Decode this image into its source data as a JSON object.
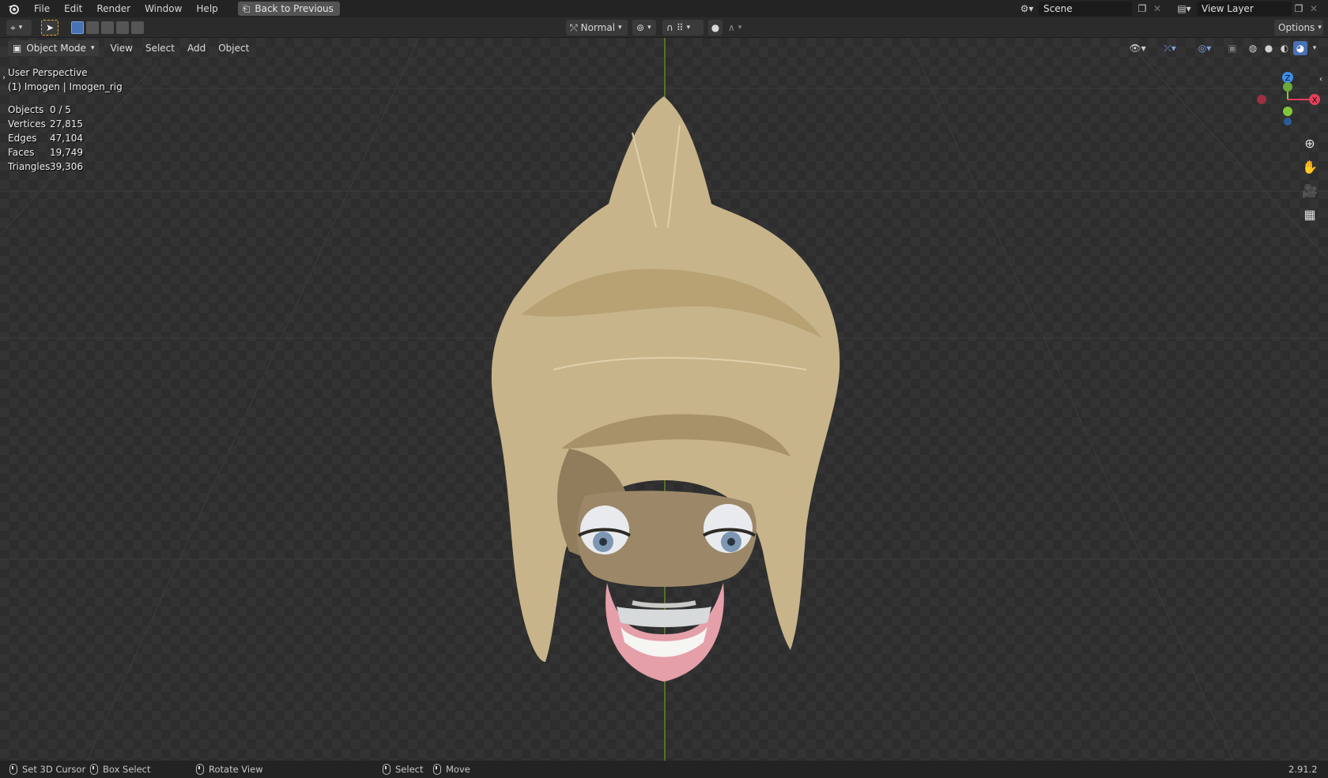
{
  "topbar": {
    "menu": [
      "File",
      "Edit",
      "Render",
      "Window",
      "Help"
    ],
    "back_button": "Back to Previous",
    "scene": "Scene",
    "view_layer": "View Layer"
  },
  "toolbar": {
    "orientation": "Normal",
    "options": "Options"
  },
  "viewport_header": {
    "mode": "Object Mode",
    "menu": [
      "View",
      "Select",
      "Add",
      "Object"
    ]
  },
  "overlay": {
    "perspective": "User Perspective",
    "object": "(1) Imogen | Imogen_rig"
  },
  "stats": [
    {
      "label": "Objects",
      "value": "0 / 5"
    },
    {
      "label": "Vertices",
      "value": "27,815"
    },
    {
      "label": "Edges",
      "value": "47,104"
    },
    {
      "label": "Faces",
      "value": "19,749"
    },
    {
      "label": "Triangles",
      "value": "39,306"
    }
  ],
  "gizmo": {
    "z": "Z",
    "x": "X"
  },
  "statusbar": {
    "set_cursor": "Set 3D Cursor",
    "box_select": "Box Select",
    "rotate_view": "Rotate View",
    "select": "Select",
    "move": "Move",
    "version": "2.91.2"
  },
  "colors": {
    "accent": "#4772b3",
    "axis_x": "#e8405a",
    "axis_y": "#80c83a",
    "axis_z": "#3a8ee8",
    "hair": "#c8b48a"
  }
}
